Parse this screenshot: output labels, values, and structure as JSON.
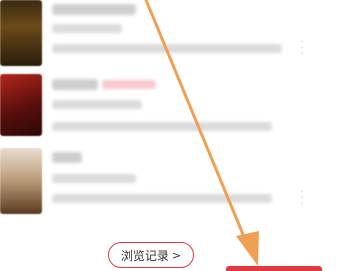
{
  "history_button": {
    "label": "浏览记录",
    "chevron": ">"
  },
  "colors": {
    "accent": "#e4393c",
    "annotation_arrow": "#f0a055"
  },
  "icons": {
    "more": "vertical-dots-icon",
    "arrow": "annotation-arrow"
  }
}
